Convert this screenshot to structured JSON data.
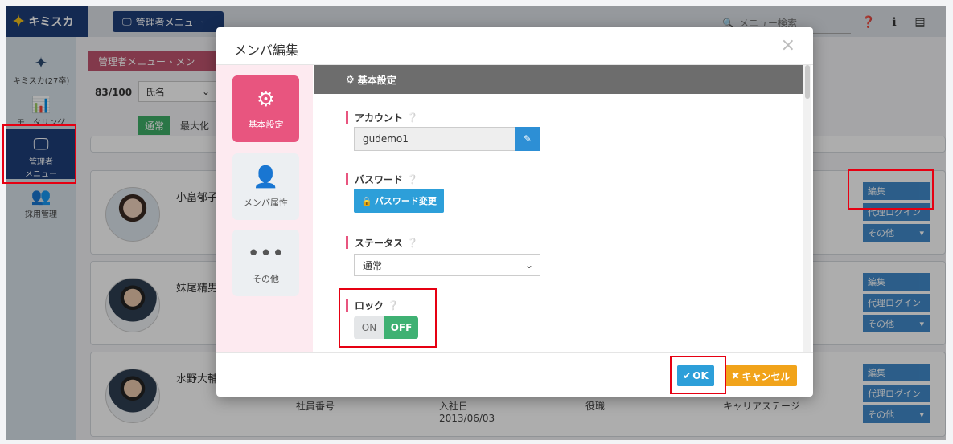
{
  "app": {
    "logo_text": "キミスカ",
    "admin_menu_label": "管理者メニュー",
    "search_placeholder": "メニュー検索"
  },
  "sidebar": {
    "items": [
      {
        "label": "キミスカ(27卒)",
        "icon": "star-icon"
      },
      {
        "label": "モニタリング",
        "icon": "chart-icon"
      },
      {
        "label_line1": "管理者",
        "label_line2": "メニュー",
        "icon": "monitor-icon",
        "active": true
      },
      {
        "label": "採用管理",
        "icon": "people-icon"
      }
    ]
  },
  "list": {
    "breadcrumb": "管理者メニュー  ›  メン",
    "count": "83/100",
    "sort_value": "氏名",
    "view_normal": "通常",
    "view_max": "最大化"
  },
  "members": [
    {
      "name": "小畠郁子",
      "buttons": [
        "編集",
        "代理ログイン",
        "その他"
      ]
    },
    {
      "name": "妹尾精男",
      "buttons": [
        "編集",
        "代理ログイン",
        "その他"
      ]
    },
    {
      "name": "水野大輔",
      "buttons": [
        "編集",
        "代理ログイン",
        "その他"
      ],
      "meta": {
        "employee_no_label": "社員番号",
        "join_label": "入社日",
        "join_date": "2013/06/03",
        "position_label": "役職",
        "career_label": "キャリアステージ"
      }
    }
  ],
  "modal": {
    "title": "メンバ編集",
    "close": "×",
    "nav": [
      {
        "label": "基本設定",
        "icon": "gear-icon",
        "active": true
      },
      {
        "label": "メンバ属性",
        "icon": "person-icon"
      },
      {
        "label": "その他",
        "icon": "dots-icon"
      }
    ],
    "section_title": "基本設定",
    "account_label": "アカウント",
    "account_value": "gudemo1",
    "password_label": "パスワード",
    "password_button": "パスワード変更",
    "status_label": "ステータス",
    "status_value": "通常",
    "lock_label": "ロック",
    "lock_on": "ON",
    "lock_off": "OFF",
    "ok_label": "OK",
    "cancel_label": "キャンセル"
  },
  "colors": {
    "brand_navy": "#1e3f79",
    "accent_pink": "#e8557f",
    "primary_blue": "#2d9fd9",
    "success_green": "#3fb173",
    "warning_orange": "#f1a31a",
    "highlight_red": "#e60012"
  }
}
